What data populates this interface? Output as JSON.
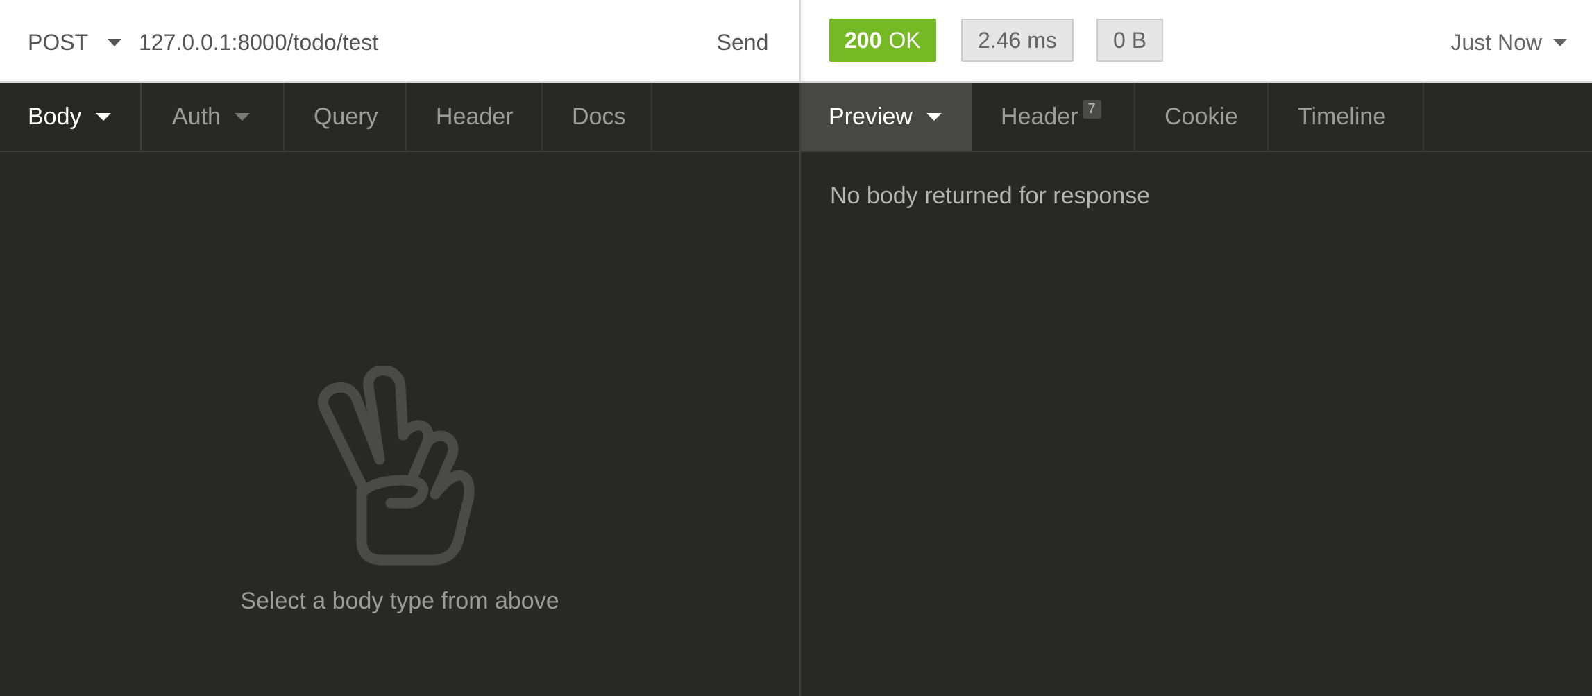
{
  "request": {
    "method": "POST",
    "url": "127.0.0.1:8000/todo/test",
    "send_label": "Send",
    "tabs": [
      {
        "label": "Body",
        "active": true
      },
      {
        "label": "Auth"
      },
      {
        "label": "Query"
      },
      {
        "label": "Header"
      },
      {
        "label": "Docs"
      }
    ],
    "empty_icon": "peace-hand-icon",
    "empty_message": "Select a body type from above"
  },
  "response": {
    "status_code": "200",
    "status_text": "OK",
    "status_color": "#75ba24",
    "time": "2.46 ms",
    "size": "0 B",
    "history_label": "Just Now",
    "tabs": [
      {
        "label": "Preview",
        "active": true
      },
      {
        "label": "Header",
        "count": "7"
      },
      {
        "label": "Cookie"
      },
      {
        "label": "Timeline"
      }
    ],
    "empty_message": "No body returned for response"
  }
}
